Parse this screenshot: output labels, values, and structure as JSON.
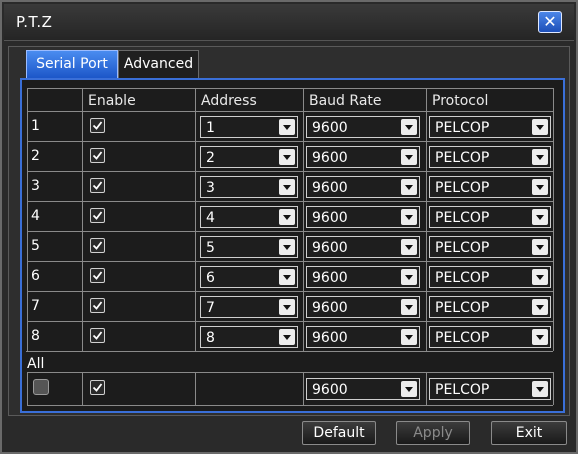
{
  "window": {
    "title": "P.T.Z"
  },
  "tabs": [
    "Serial Port",
    "Advanced"
  ],
  "table": {
    "headers": [
      "Enable",
      "Address",
      "Baud Rate",
      "Protocol"
    ],
    "rows": [
      {
        "num": "1",
        "enabled": true,
        "address": "1",
        "baud": "9600",
        "protocol": "PELCOP"
      },
      {
        "num": "2",
        "enabled": true,
        "address": "2",
        "baud": "9600",
        "protocol": "PELCOP"
      },
      {
        "num": "3",
        "enabled": true,
        "address": "3",
        "baud": "9600",
        "protocol": "PELCOP"
      },
      {
        "num": "4",
        "enabled": true,
        "address": "4",
        "baud": "9600",
        "protocol": "PELCOP"
      },
      {
        "num": "5",
        "enabled": true,
        "address": "5",
        "baud": "9600",
        "protocol": "PELCOP"
      },
      {
        "num": "6",
        "enabled": true,
        "address": "6",
        "baud": "9600",
        "protocol": "PELCOP"
      },
      {
        "num": "7",
        "enabled": true,
        "address": "7",
        "baud": "9600",
        "protocol": "PELCOP"
      },
      {
        "num": "8",
        "enabled": true,
        "address": "8",
        "baud": "9600",
        "protocol": "PELCOP"
      }
    ]
  },
  "all": {
    "label": "All",
    "enabled": true,
    "baud": "9600",
    "protocol": "PELCOP"
  },
  "buttons": {
    "default": "Default",
    "apply": "Apply",
    "exit": "Exit"
  },
  "colors": {
    "accent": "#3a6fd8",
    "tab_active": "#2f6fe0"
  }
}
